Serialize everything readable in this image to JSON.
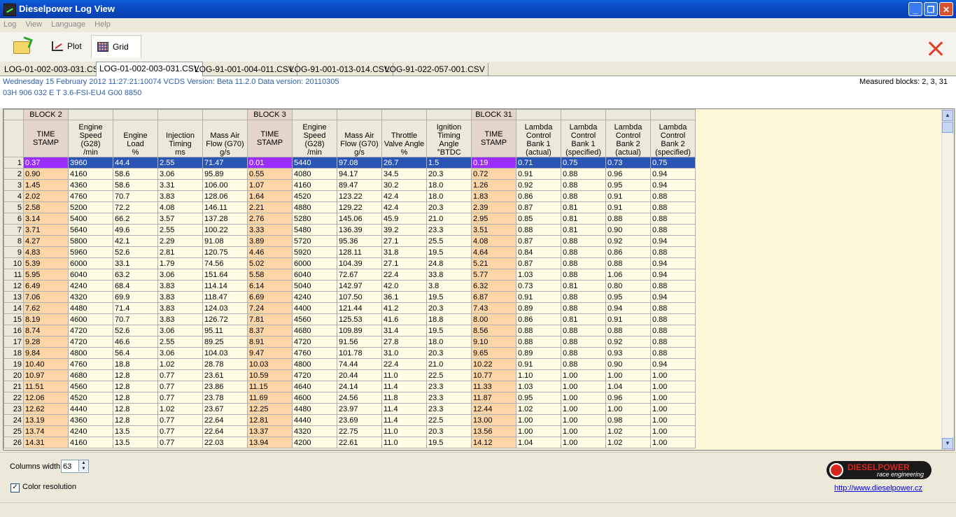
{
  "window": {
    "title": "Dieselpower Log View"
  },
  "menu": [
    "Log",
    "View",
    "Language",
    "Help"
  ],
  "toolbar": {
    "plot_label": "Plot",
    "grid_label": "Grid"
  },
  "tabs": [
    "LOG-01-002-003-031.CSV",
    "LOG-01-002-003-031.CSV",
    "LOG-91-001-004-011.CSV",
    "LOG-91-001-013-014.CSV",
    "LOG-91-022-057-001.CSV"
  ],
  "active_tab": 1,
  "info": {
    "line1": "Wednesday 15 February 2012 11:27:21:10074 VCDS Version: Beta 11.2.0 Data version: 20110305",
    "line2": "03H 906 032 E   T 3.6-FSI-EU4    G00 8850",
    "measured_blocks": "Measured blocks: 2, 3, 31"
  },
  "grid": {
    "block_headers": [
      {
        "col": 0,
        "label": "BLOCK 2"
      },
      {
        "col": 5,
        "label": "BLOCK 3"
      },
      {
        "col": 10,
        "label": "BLOCK 31"
      }
    ],
    "columns": [
      {
        "name": "TIME STAMP",
        "unit": "",
        "ts": true
      },
      {
        "name": "Engine Speed (G28)",
        "unit": "/min"
      },
      {
        "name": "Engine Load",
        "unit": "%"
      },
      {
        "name": "Injection Timing",
        "unit": "ms"
      },
      {
        "name": "Mass Air Flow (G70)",
        "unit": "g/s"
      },
      {
        "name": "TIME STAMP",
        "unit": "",
        "ts": true
      },
      {
        "name": "Engine Speed (G28)",
        "unit": "/min"
      },
      {
        "name": "Mass Air Flow (G70)",
        "unit": "g/s"
      },
      {
        "name": "Throttle Valve Angle",
        "unit": "%"
      },
      {
        "name": "Ignition Timing Angle",
        "unit": "°BTDC"
      },
      {
        "name": "TIME STAMP",
        "unit": "",
        "ts": true
      },
      {
        "name": "Lambda Control Bank 1",
        "unit": "(actual)"
      },
      {
        "name": "Lambda Control Bank 1",
        "unit": "(specified)"
      },
      {
        "name": "Lambda Control Bank 2",
        "unit": "(actual)"
      },
      {
        "name": "Lambda Control Bank 2",
        "unit": "(specified)"
      }
    ],
    "selected_row": 0,
    "rows": [
      [
        "0.37",
        "3960",
        "44.4",
        "2.55",
        "71.47",
        "0.01",
        "5440",
        "97.08",
        "26.7",
        "1.5",
        "0.19",
        "0.71",
        "0.75",
        "0.73",
        "0.75"
      ],
      [
        "0.90",
        "4160",
        "58.6",
        "3.06",
        "95.89",
        "0.55",
        "4080",
        "94.17",
        "34.5",
        "20.3",
        "0.72",
        "0.91",
        "0.88",
        "0.96",
        "0.94"
      ],
      [
        "1.45",
        "4360",
        "58.6",
        "3.31",
        "106.00",
        "1.07",
        "4160",
        "89.47",
        "30.2",
        "18.0",
        "1.26",
        "0.92",
        "0.88",
        "0.95",
        "0.94"
      ],
      [
        "2.02",
        "4760",
        "70.7",
        "3.83",
        "128.06",
        "1.64",
        "4520",
        "123.22",
        "42.4",
        "18.0",
        "1.83",
        "0.86",
        "0.88",
        "0.91",
        "0.88"
      ],
      [
        "2.58",
        "5200",
        "72.2",
        "4.08",
        "146.11",
        "2.21",
        "4880",
        "129.22",
        "42.4",
        "20.3",
        "2.39",
        "0.87",
        "0.81",
        "0.91",
        "0.88"
      ],
      [
        "3.14",
        "5400",
        "66.2",
        "3.57",
        "137.28",
        "2.76",
        "5280",
        "145.06",
        "45.9",
        "21.0",
        "2.95",
        "0.85",
        "0.81",
        "0.88",
        "0.88"
      ],
      [
        "3.71",
        "5640",
        "49.6",
        "2.55",
        "100.22",
        "3.33",
        "5480",
        "136.39",
        "39.2",
        "23.3",
        "3.51",
        "0.88",
        "0.81",
        "0.90",
        "0.88"
      ],
      [
        "4.27",
        "5800",
        "42.1",
        "2.29",
        "91.08",
        "3.89",
        "5720",
        "95.36",
        "27.1",
        "25.5",
        "4.08",
        "0.87",
        "0.88",
        "0.92",
        "0.94"
      ],
      [
        "4.83",
        "5960",
        "52.6",
        "2.81",
        "120.75",
        "4.46",
        "5920",
        "128.11",
        "31.8",
        "19.5",
        "4.64",
        "0.84",
        "0.88",
        "0.86",
        "0.88"
      ],
      [
        "5.39",
        "6000",
        "33.1",
        "1.79",
        "74.56",
        "5.02",
        "6000",
        "104.39",
        "27.1",
        "24.8",
        "5.21",
        "0.87",
        "0.88",
        "0.88",
        "0.94"
      ],
      [
        "5.95",
        "6040",
        "63.2",
        "3.06",
        "151.64",
        "5.58",
        "6040",
        "72.67",
        "22.4",
        "33.8",
        "5.77",
        "1.03",
        "0.88",
        "1.06",
        "0.94"
      ],
      [
        "6.49",
        "4240",
        "68.4",
        "3.83",
        "114.14",
        "6.14",
        "5040",
        "142.97",
        "42.0",
        "3.8",
        "6.32",
        "0.73",
        "0.81",
        "0.80",
        "0.88"
      ],
      [
        "7.06",
        "4320",
        "69.9",
        "3.83",
        "118.47",
        "6.69",
        "4240",
        "107.50",
        "36.1",
        "19.5",
        "6.87",
        "0.91",
        "0.88",
        "0.95",
        "0.94"
      ],
      [
        "7.62",
        "4480",
        "71.4",
        "3.83",
        "124.03",
        "7.24",
        "4400",
        "121.44",
        "41.2",
        "20.3",
        "7.43",
        "0.89",
        "0.88",
        "0.94",
        "0.88"
      ],
      [
        "8.19",
        "4600",
        "70.7",
        "3.83",
        "126.72",
        "7.81",
        "4560",
        "125.53",
        "41.6",
        "18.8",
        "8.00",
        "0.86",
        "0.81",
        "0.91",
        "0.88"
      ],
      [
        "8.74",
        "4720",
        "52.6",
        "3.06",
        "95.11",
        "8.37",
        "4680",
        "109.89",
        "31.4",
        "19.5",
        "8.56",
        "0.88",
        "0.88",
        "0.88",
        "0.88"
      ],
      [
        "9.28",
        "4720",
        "46.6",
        "2.55",
        "89.25",
        "8.91",
        "4720",
        "91.56",
        "27.8",
        "18.0",
        "9.10",
        "0.88",
        "0.88",
        "0.92",
        "0.88"
      ],
      [
        "9.84",
        "4800",
        "56.4",
        "3.06",
        "104.03",
        "9.47",
        "4760",
        "101.78",
        "31.0",
        "20.3",
        "9.65",
        "0.89",
        "0.88",
        "0.93",
        "0.88"
      ],
      [
        "10.40",
        "4760",
        "18.8",
        "1.02",
        "28.78",
        "10.03",
        "4800",
        "74.44",
        "22.4",
        "21.0",
        "10.22",
        "0.91",
        "0.88",
        "0.90",
        "0.94"
      ],
      [
        "10.97",
        "4680",
        "12.8",
        "0.77",
        "23.61",
        "10.59",
        "4720",
        "20.44",
        "11.0",
        "22.5",
        "10.77",
        "1.10",
        "1.00",
        "1.00",
        "1.00"
      ],
      [
        "11.51",
        "4560",
        "12.8",
        "0.77",
        "23.86",
        "11.15",
        "4640",
        "24.14",
        "11.4",
        "23.3",
        "11.33",
        "1.03",
        "1.00",
        "1.04",
        "1.00"
      ],
      [
        "12.06",
        "4520",
        "12.8",
        "0.77",
        "23.78",
        "11.69",
        "4600",
        "24.56",
        "11.8",
        "23.3",
        "11.87",
        "0.95",
        "1.00",
        "0.96",
        "1.00"
      ],
      [
        "12.62",
        "4440",
        "12.8",
        "1.02",
        "23.67",
        "12.25",
        "4480",
        "23.97",
        "11.4",
        "23.3",
        "12.44",
        "1.02",
        "1.00",
        "1.00",
        "1.00"
      ],
      [
        "13.19",
        "4360",
        "12.8",
        "0.77",
        "22.64",
        "12.81",
        "4440",
        "23.69",
        "11.4",
        "22.5",
        "13.00",
        "1.00",
        "1.00",
        "0.98",
        "1.00"
      ],
      [
        "13.74",
        "4240",
        "13.5",
        "0.77",
        "22.64",
        "13.37",
        "4320",
        "22.75",
        "11.0",
        "20.3",
        "13.56",
        "1.00",
        "1.00",
        "1.02",
        "1.00"
      ],
      [
        "14.31",
        "4160",
        "13.5",
        "0.77",
        "22.03",
        "13.94",
        "4200",
        "22.61",
        "11.0",
        "19.5",
        "14.12",
        "1.04",
        "1.00",
        "1.02",
        "1.00"
      ]
    ]
  },
  "bottom": {
    "columns_width_label": "Columns width:",
    "columns_width_value": "63",
    "color_resolution_label": "Color resolution",
    "color_resolution_checked": true,
    "logo_text": "DIESELPOWER",
    "logo_sub": "race engineering",
    "link": "http://www.dieselpower.cz"
  }
}
